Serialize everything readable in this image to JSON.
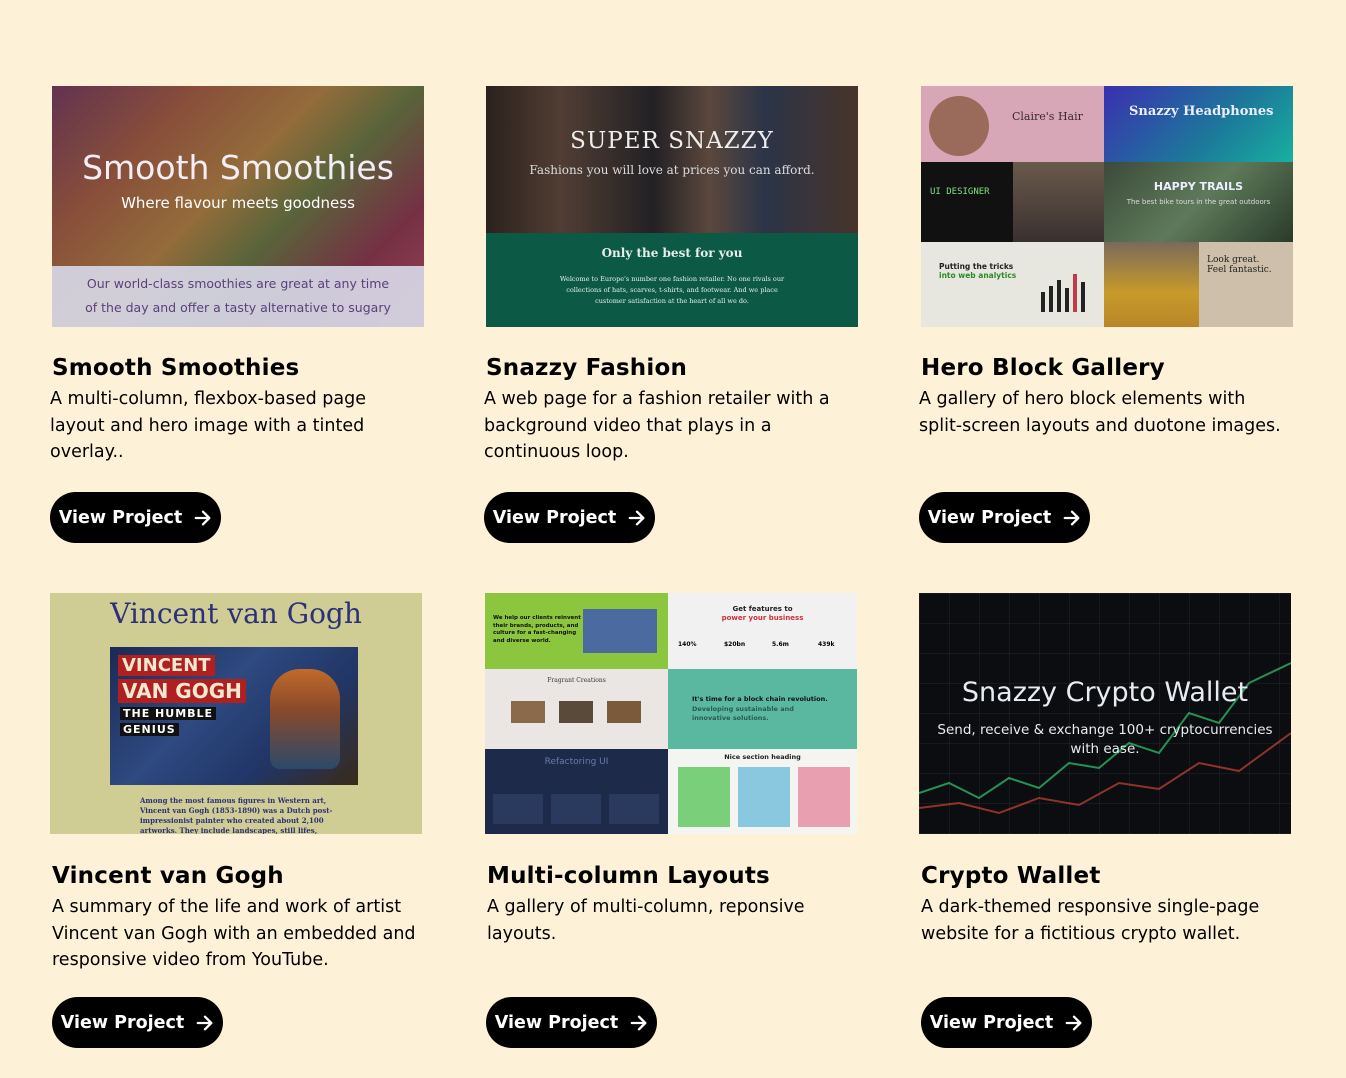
{
  "projects": [
    {
      "title": "Smooth Smoothies",
      "description": "A multi-column, flexbox-based page layout and hero image with a tinted overlay..",
      "button": "View Project",
      "thumb": {
        "heading": "Smooth Smoothies",
        "tagline": "Where flavour meets goodness",
        "line1": "Our world-class smoothies are great at any time",
        "line2": "of the day and offer a tasty alternative to sugary"
      }
    },
    {
      "title": "Snazzy Fashion",
      "description": "A web page for a fashion retailer with a background video that plays in a continuous loop.",
      "button": "View Project",
      "thumb": {
        "heading": "SUPER SNAZZY",
        "tagline": "Fashions you will love at prices you can afford.",
        "band_heading": "Only the best for you",
        "band_text": "Welcome to Europe's number one fashion retailer. No one rivals our collections of hats, scarves, t-shirts, and footwear. And we place customer satisfaction at the heart of all we do."
      }
    },
    {
      "title": "Hero Block Gallery",
      "description": "A gallery of hero block elements with split-screen layouts and duotone images.",
      "button": "View Project",
      "thumb": {
        "claires": "Claire's Hair",
        "headphones": "Snazzy Headphones",
        "ui_designer": "UI DESIGNER",
        "trails": "HAPPY TRAILS",
        "trails_sub": "The best bike tours in the great outdoors",
        "analytics_1": "Putting the tricks",
        "analytics_2": "into web analytics",
        "look_great": "Look great.",
        "feel_fantastic": "Feel fantastic."
      }
    },
    {
      "title": "Vincent van Gogh",
      "description": "A summary of the life and work of artist Vincent van Gogh with an embedded and responsive video from YouTube.",
      "button": "View Project",
      "thumb": {
        "heading": "Vincent van Gogh",
        "video_line1": "VINCENT",
        "video_line2": "VAN GOGH",
        "video_line3": "THE HUMBLE",
        "video_line4": "GENIUS",
        "para": "Among the most famous figures in Western art, Vincent van Gogh (1853-1890) was a Dutch post-impressionist painter who created about 2,100 artworks. They include landscapes, still lifes, portraits and self-portraits, and are"
      }
    },
    {
      "title": "Multi-column Layouts",
      "description": "A gallery of multi-column, reponsive layouts.",
      "button": "View Project",
      "thumb": {
        "q1": "We help our clients reinvent their brands, products, and culture for a fast-changing and diverse world.",
        "q2_title": "Get features to",
        "q2_sub": "power your business",
        "stats": [
          "140%",
          "$20bn",
          "5.6m",
          "439k"
        ],
        "q3": "Fragrant Creations",
        "q4": "It's time for a block chain revolution.",
        "q4_sub": "Developing sustainable and innovative solutions.",
        "q5": "Refactoring UI",
        "q6": "Nice section heading"
      }
    },
    {
      "title": "Crypto Wallet",
      "description": "A dark-themed responsive single-page website for a fictitious crypto wallet.",
      "button": "View Project",
      "thumb": {
        "heading": "Snazzy Crypto Wallet",
        "tagline": "Send, receive & exchange 100+ cryptocurrencies with ease."
      }
    }
  ]
}
